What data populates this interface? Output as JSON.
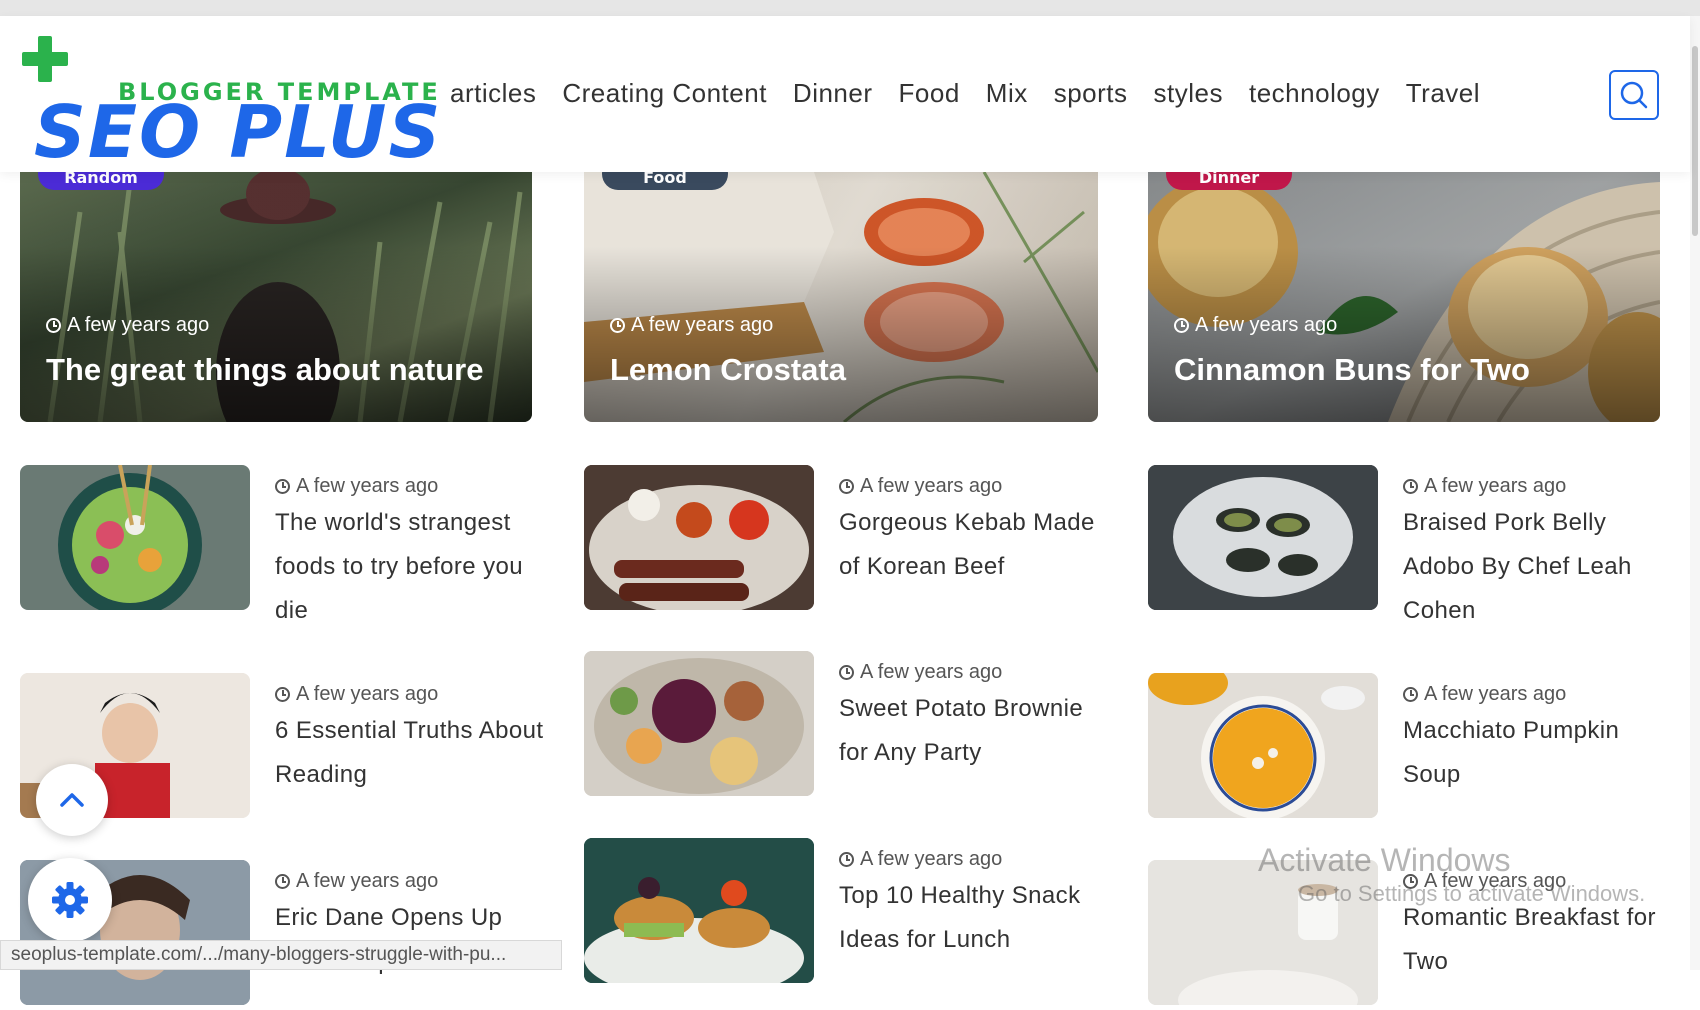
{
  "logo": {
    "tagline": "BLOGGER TEMPLATE",
    "brand": "SEO PLUS"
  },
  "nav": [
    "articles",
    "Creating Content",
    "Dinner",
    "Food",
    "Mix",
    "sports",
    "styles",
    "technology",
    "Travel"
  ],
  "search_icon": "search-icon",
  "featured": [
    {
      "badge": "Random",
      "badge_color": "#4b2bd6",
      "meta": "A few years ago",
      "title": "The great things about nature"
    },
    {
      "badge": "Food",
      "badge_color": "#3a4a5e",
      "meta": "A few years ago",
      "title": "Lemon Crostata"
    },
    {
      "badge": "Dinner",
      "badge_color": "#c0174a",
      "meta": "A few years ago",
      "title": "Cinnamon Buns for Two"
    }
  ],
  "posts": [
    {
      "meta": "A few years ago",
      "title": "The world's strangest foods to try before you die"
    },
    {
      "meta": "A few years ago",
      "title": "Gorgeous Kebab Made of Korean Beef"
    },
    {
      "meta": "A few years ago",
      "title": "Braised Pork Belly Adobo By Chef Leah Cohen"
    },
    {
      "meta": "A few years ago",
      "title": "6 Essential Truths About Reading"
    },
    {
      "meta": "A few years ago",
      "title": "Sweet Potato Brownie for Any Party"
    },
    {
      "meta": "A few years ago",
      "title": "Macchiato Pumpkin Soup"
    },
    {
      "meta": "A few years ago",
      "title": "Eric Dane Opens Up About Depression"
    },
    {
      "meta": "A few years ago",
      "title": "Top 10 Healthy Snack Ideas for Lunch"
    },
    {
      "meta": "A few years ago",
      "title": "Romantic Breakfast for Two"
    }
  ],
  "fab": {
    "up_icon": "chevron-up-icon",
    "settings_icon": "gear-icon"
  },
  "status_url": "seoplus-template.com/.../many-bloggers-struggle-with-pu...",
  "watermark": {
    "line1": "Activate Windows",
    "line2": "Go to Settings to activate Windows."
  },
  "colors": {
    "brand_blue": "#1e67e8",
    "brand_green": "#2bb24c"
  }
}
